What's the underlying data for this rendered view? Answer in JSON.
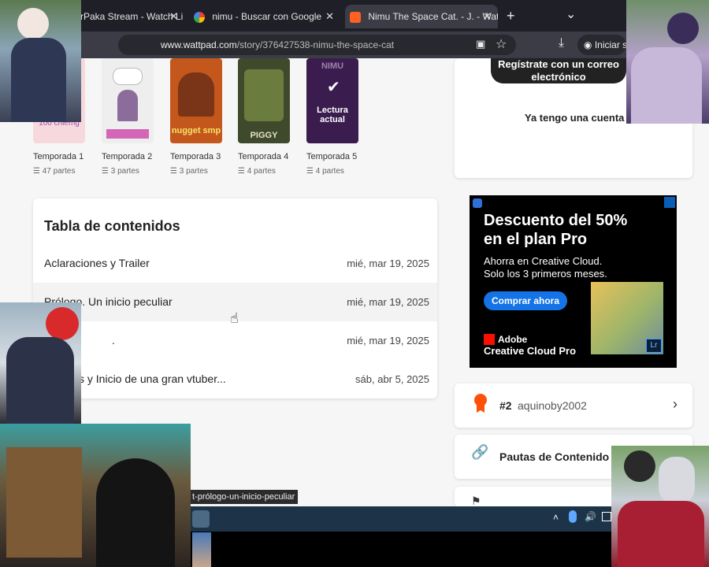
{
  "browser": {
    "tabs": [
      {
        "label": "rPaka Stream - Watch Li",
        "active": false
      },
      {
        "label": "nimu - Buscar con Google",
        "active": false
      },
      {
        "label": "Nimu The Space Cat. - J. - Watt",
        "active": true
      }
    ],
    "url_domain": "www.wattpad.com",
    "url_path": "/story/376427538-nimu-the-space-cat",
    "signin_label": "Iniciar s",
    "new_tab": "+",
    "tab_close": "✕",
    "tab_list": "⌄",
    "star": "☆",
    "lock": "🔒",
    "download": "⤓",
    "status_url": "t-prólogo-un-inicio-peculiar"
  },
  "seasons": [
    {
      "label": "Temporada 1",
      "parts": "47 partes",
      "cover_text": "100 chiemg",
      "bg": "#f7d9dd"
    },
    {
      "label": "Temporada 2",
      "parts": "3 partes",
      "cover_text": "",
      "bg": "#eeeeee"
    },
    {
      "label": "Temporada 3",
      "parts": "3 partes",
      "cover_text": "nugget smp",
      "bg": "#c4571b"
    },
    {
      "label": "Temporada 4",
      "parts": "4 partes",
      "cover_text": "PIGGY",
      "bg": "#3f4a2c"
    },
    {
      "label": "Temporada 5",
      "parts": "4 partes",
      "cover_text": "Lectura actual",
      "bg": "#5a2c7a"
    }
  ],
  "cover5_top": "NIMU",
  "toc": {
    "title": "Tabla de contenidos",
    "rows": [
      {
        "title": "Aclaraciones y Trailer",
        "date": "mié, mar 19, 2025"
      },
      {
        "title": "Prólogo. Un inicio peculiar",
        "date": "mié, mar 19, 2025"
      },
      {
        "title": ".",
        "date": "mié, mar 19, 2025"
      },
      {
        "title": "s y Inicio de una gran vtuber...",
        "date": "sáb, abr 5, 2025"
      }
    ]
  },
  "sidebar": {
    "register_button": "Regístrate con un correo electrónico",
    "login_link": "Ya tengo una cuenta",
    "rank_number": "#2",
    "rank_user": "aquinoby2002",
    "guidelines": "Pautas de Contenido"
  },
  "ad": {
    "headline": "Descuento del 50% en el plan Pro",
    "body_line1": "Ahorra en Creative Cloud.",
    "body_line2": "Solo los 3 primeros meses.",
    "cta": "Comprar ahora",
    "brand_line1": "Adobe",
    "brand_line2": "Creative Cloud Pro",
    "lr_badge": "Lr"
  },
  "colors": {
    "accent": "#ff500a",
    "wattpad_orange": "#ff6122",
    "ad_cta": "#1473e6"
  }
}
